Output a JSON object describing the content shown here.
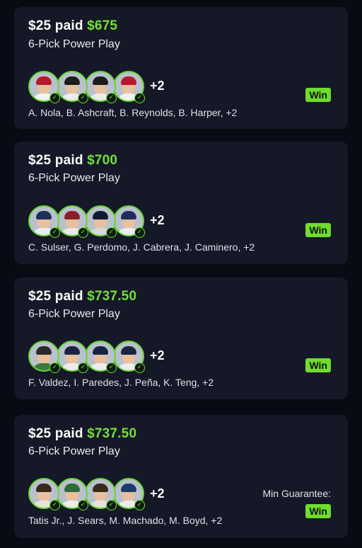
{
  "entries": [
    {
      "paid": "$25 paid",
      "payout": "$675",
      "type": "6-Pick Power Play",
      "extra": "+2",
      "players": "A. Nola, B. Ashcraft, B. Reynolds, B. Harper, +2",
      "result": "Win",
      "avatars": [
        {
          "icon": "player-avatar-icon",
          "cap": "#b8182c",
          "jersey": "#f2f2f2"
        },
        {
          "icon": "player-avatar-icon",
          "cap": "#1c1c1c",
          "jersey": "#ececec"
        },
        {
          "icon": "player-avatar-icon",
          "cap": "#1c1c1c",
          "jersey": "#ececec"
        },
        {
          "icon": "player-avatar-icon",
          "cap": "#b8182c",
          "jersey": "#f2f2f2"
        }
      ]
    },
    {
      "paid": "$25 paid",
      "payout": "$700",
      "type": "6-Pick Power Play",
      "extra": "+2",
      "players": "C. Sulser, G. Perdomo, J. Cabrera, J. Caminero, +2",
      "result": "Win",
      "avatars": [
        {
          "icon": "player-avatar-icon",
          "cap": "#1f2f5a",
          "jersey": "#e9eef5"
        },
        {
          "icon": "player-avatar-icon",
          "cap": "#8a1f2c",
          "jersey": "#e9e9e9"
        },
        {
          "icon": "player-avatar-icon",
          "cap": "#0f1a33",
          "jersey": "#d9d9d9"
        },
        {
          "icon": "player-avatar-icon",
          "cap": "#1f2f5a",
          "jersey": "#e9eef5"
        }
      ]
    },
    {
      "paid": "$25 paid",
      "payout": "$737.50",
      "type": "6-Pick Power Play",
      "extra": "+2",
      "players": "F. Valdez, I. Paredes, J. Peña, K. Teng, +2",
      "result": "Win",
      "avatars": [
        {
          "icon": "player-avatar-icon",
          "cap": "#2a2a2a",
          "jersey": "#3b7a3b"
        },
        {
          "icon": "player-avatar-icon",
          "cap": "#1a2440",
          "jersey": "#ededed"
        },
        {
          "icon": "player-avatar-icon",
          "cap": "#1a2440",
          "jersey": "#ededed"
        },
        {
          "icon": "player-avatar-icon",
          "cap": "#1a2440",
          "jersey": "#ededed"
        }
      ]
    },
    {
      "paid": "$25 paid",
      "payout": "$737.50",
      "type": "6-Pick Power Play",
      "extra": "+2",
      "players": "Tatis Jr., J. Sears, M. Machado, M. Boyd, +2",
      "guarantee": "Min Guarantee:",
      "result": "Win",
      "avatars": [
        {
          "icon": "player-avatar-icon",
          "cap": "#3a2a1c",
          "jersey": "#e7e2d6"
        },
        {
          "icon": "player-avatar-icon",
          "cap": "#2e6b3a",
          "jersey": "#ededed"
        },
        {
          "icon": "player-avatar-icon",
          "cap": "#3a2a1c",
          "jersey": "#e7e2d6"
        },
        {
          "icon": "player-avatar-icon",
          "cap": "#1d3a6b",
          "jersey": "#ededed"
        }
      ]
    }
  ],
  "colors": {
    "background": "#090b14",
    "card": "#151826",
    "accent_green": "#74e03a",
    "win_badge": "#6fdc2e"
  }
}
